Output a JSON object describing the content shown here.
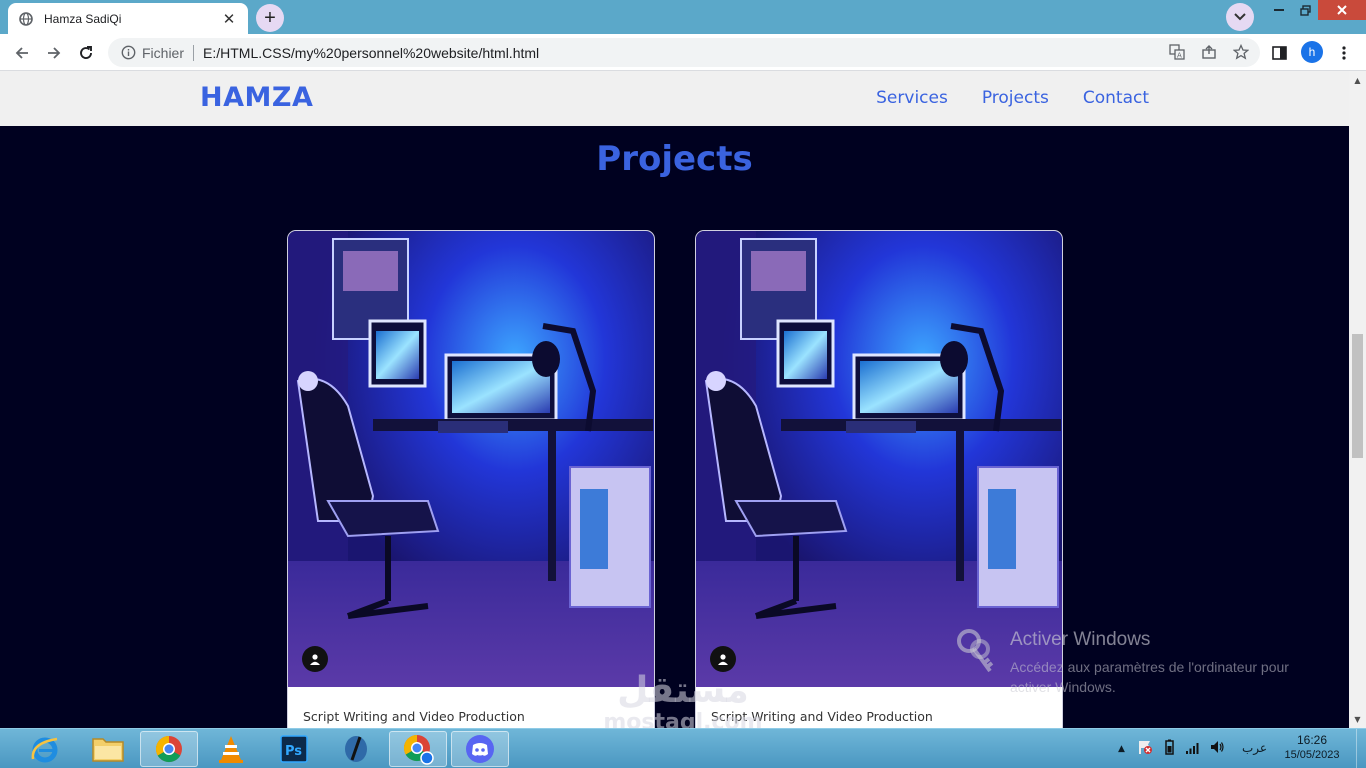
{
  "browser": {
    "tab_title": "Hamza SadiQi",
    "tab_close": "✕",
    "new_tab": "+",
    "address_scheme": "Fichier",
    "address_url": "E:/HTML.CSS/my%20personnel%20website/html.html",
    "profile_initial": "h"
  },
  "site": {
    "logo": "HAMZA",
    "nav": [
      "Services",
      "Projects",
      "Contact"
    ],
    "section_title": "Projects",
    "projects": [
      {
        "caption": "Script Writing and Video Production"
      },
      {
        "caption": "Script Writing and Video Production"
      }
    ]
  },
  "overlay": {
    "activate_title": "Activer Windows",
    "activate_sub": "Accédez aux paramètres de l'ordinateur pour activer Windows.",
    "watermark_ar": "مستقل",
    "watermark_en": "mostaql.com"
  },
  "taskbar": {
    "apps": [
      "internet-explorer",
      "file-explorer",
      "chrome",
      "vlc",
      "photoshop",
      "inkscape",
      "chrome-profile",
      "discord"
    ],
    "language": "عرب",
    "time": "16:26",
    "date": "15/05/2023"
  },
  "colors": {
    "accent": "#3a63e0",
    "page_bg": "#000120",
    "header_bg": "#f0f0f0",
    "tabbar_bg": "#5ba8c9"
  }
}
